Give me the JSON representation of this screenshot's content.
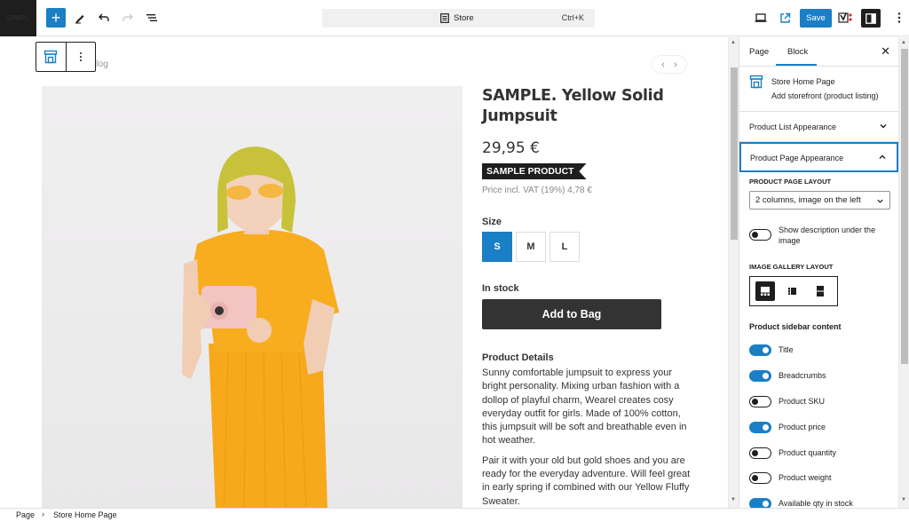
{
  "topbar": {
    "site_logo_text": "SIMPL",
    "document_title": "Store",
    "shortcut": "Ctrl+K",
    "save_label": "Save",
    "icons": [
      "plus-icon",
      "pencil-tools-icon",
      "undo-icon",
      "redo-icon",
      "document-overview-icon",
      "desktop-preview-icon",
      "external-view-icon",
      "yoast-icon",
      "sidebar-settings-icon",
      "more-options-icon"
    ]
  },
  "canvas": {
    "breadcrumb_partial": "log",
    "product": {
      "title": "SAMPLE. Yellow Solid Jumpsuit",
      "price": "29,95 €",
      "badge": "SAMPLE PRODUCT",
      "vat_text": "Price incl. VAT (19%) 4,78 €",
      "size_label": "Size",
      "sizes": [
        {
          "label": "S",
          "selected": true
        },
        {
          "label": "M",
          "selected": false
        },
        {
          "label": "L",
          "selected": false
        }
      ],
      "stock_status": "In stock",
      "add_to_bag_label": "Add to Bag",
      "details_heading": "Product Details",
      "details_paragraphs": [
        "Sunny comfortable jumpsuit to express your bright personality. Mixing urban fashion with a dollop of playful charm, Wearel creates cosy everyday outfit for girls. Made of 100% cotton, this jumpsuit will be soft and breathable even in hot weather.",
        "Pair it with your old but gold shoes and you are ready for the everyday adventure. Will feel great in early spring if combined with our Yellow Fluffy Sweater."
      ]
    },
    "nav_prev": "‹",
    "nav_next": "›"
  },
  "sidebar": {
    "tabs": [
      {
        "label": "Page",
        "active": false
      },
      {
        "label": "Block",
        "active": true
      }
    ],
    "block": {
      "name": "Store Home Page",
      "description": "Add storefront (product listing)"
    },
    "panels": [
      {
        "label": "Product List Appearance",
        "open": false
      },
      {
        "label": "Product Page Appearance",
        "open": true
      }
    ],
    "product_page_layout_label": "PRODUCT PAGE LAYOUT",
    "product_page_layout_value": "2 columns, image on the left",
    "show_description_label": "Show description under the image",
    "show_description_on": false,
    "image_gallery_layout_label": "IMAGE GALLERY LAYOUT",
    "gallery_options": [
      "gallery-bottom-icon",
      "gallery-left-icon",
      "gallery-stacked-icon"
    ],
    "gallery_selected": 0,
    "sidebar_content_heading": "Product sidebar content",
    "sidebar_content_toggles": [
      {
        "label": "Title",
        "on": true
      },
      {
        "label": "Breadcrumbs",
        "on": true
      },
      {
        "label": "Product SKU",
        "on": false
      },
      {
        "label": "Product price",
        "on": true
      },
      {
        "label": "Product quantity",
        "on": false
      },
      {
        "label": "Product weight",
        "on": false
      },
      {
        "label": "Available qty in stock",
        "on": true
      }
    ]
  },
  "footer": {
    "breadcrumb": [
      "Page",
      "Store Home Page"
    ]
  },
  "colors": {
    "accent": "#1a7fc4",
    "dark": "#1e1e1e",
    "jumpsuit": "#f7a81b"
  }
}
